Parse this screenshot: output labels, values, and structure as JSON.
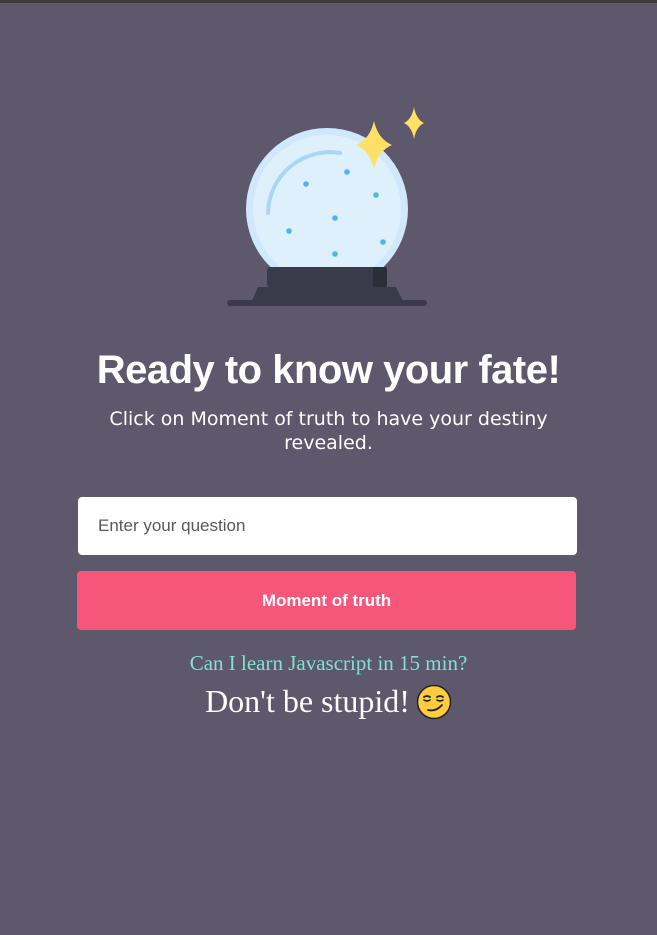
{
  "illustration": {
    "icon": "crystal-ball-icon",
    "sparkle_icon": "sparkle-icon"
  },
  "header": {
    "title": "Ready to know your fate!",
    "subtitle": "Click on Moment of truth to have your destiny revealed."
  },
  "form": {
    "question_placeholder": "Enter your question",
    "question_value": "",
    "submit_label": "Moment of truth"
  },
  "result": {
    "question": "Can I learn Javascript in 15 min?",
    "answer": "Don't be stupid!",
    "answer_icon": "smirking-face-icon"
  },
  "colors": {
    "background": "#5d586b",
    "button": "#f5567a",
    "question_text": "#7fe3cf",
    "text": "#ffffff"
  }
}
